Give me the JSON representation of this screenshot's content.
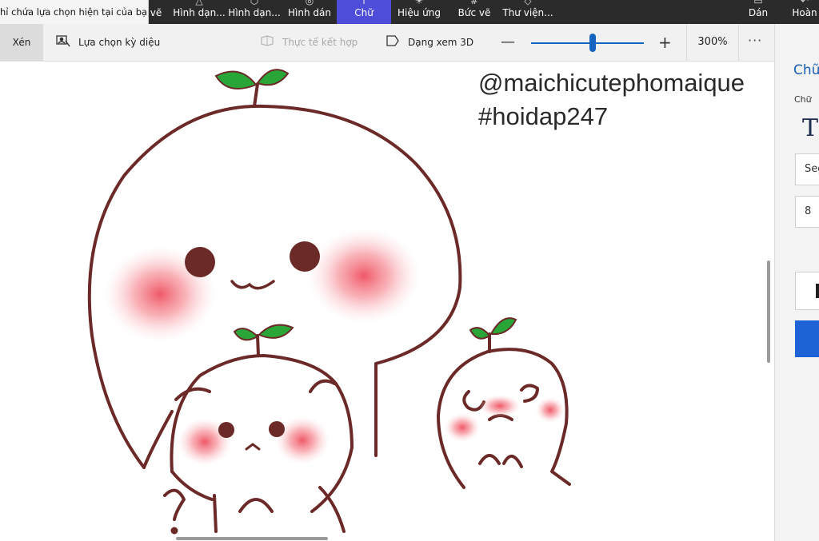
{
  "tooltip": "hỉ chứa lựa chọn hiện tại của bạn.",
  "menu": {
    "items": [
      {
        "label": "vẽ"
      },
      {
        "label": "Hình dạn..."
      },
      {
        "label": "Hình dạn..."
      },
      {
        "label": "Hình dán"
      },
      {
        "label": "Chữ"
      },
      {
        "label": "Hiệu ứng"
      },
      {
        "label": "Bức vẽ"
      },
      {
        "label": "Thư viện..."
      },
      {
        "label": "Dán"
      },
      {
        "label": "Hoàn"
      }
    ],
    "active": "Chữ",
    "accent": "#4d4dd9"
  },
  "toolbar": {
    "crop_label": "Xén",
    "magic_select_label": "Lựa chọn kỳ diệu",
    "mixed_reality_label": "Thực tế kết hợp",
    "view3d_label": "Dạng xem 3D",
    "zoom_minus": "—",
    "zoom_plus": "+",
    "zoom_value": "300%",
    "zoom_level_fraction": 0.52,
    "more": "···",
    "accent": "#1565c0"
  },
  "canvas": {
    "watermark_line1": "@maichicutephomaique",
    "watermark_line2": "#hoidap247"
  },
  "panel": {
    "title": "Chữ",
    "subtitle": "Chữ",
    "font_preview": "T",
    "font_name": "Seg",
    "font_size": "8",
    "accent": "#1e63d6"
  }
}
